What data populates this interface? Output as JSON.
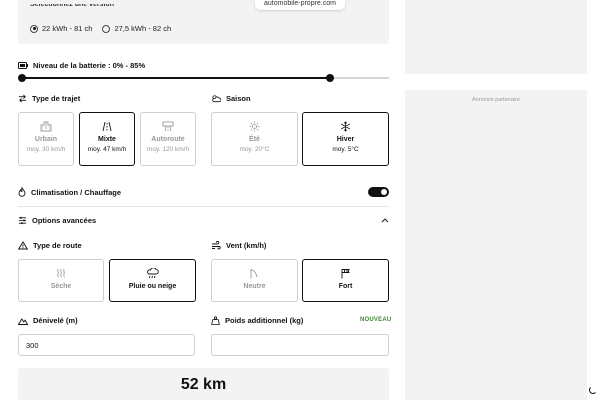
{
  "browser": {
    "url": "automobile-propre.com"
  },
  "version": {
    "heading": "Sélectionnez une version",
    "options": [
      {
        "label": "22 kWh - 81 ch",
        "selected": true
      },
      {
        "label": "27,5 kWh - 82 ch",
        "selected": false
      }
    ]
  },
  "battery": {
    "label": "Niveau de la batterie : 0% - 85%",
    "min_percent": 0,
    "max_percent": 85
  },
  "trip_type": {
    "label": "Type de trajet",
    "options": [
      {
        "title": "Urbain",
        "sub": "moy. 30 km/h",
        "icon": "building-icon",
        "selected": false
      },
      {
        "title": "Mixte",
        "sub": "moy. 47 km/h",
        "icon": "mixed-road-icon",
        "selected": true
      },
      {
        "title": "Autoroute",
        "sub": "moy. 120 km/h",
        "icon": "highway-icon",
        "selected": false
      }
    ]
  },
  "season": {
    "label": "Saison",
    "options": [
      {
        "title": "Été",
        "sub": "moy. 20°C",
        "icon": "sun-icon",
        "selected": false
      },
      {
        "title": "Hiver",
        "sub": "moy. 5°C",
        "icon": "snowflake-icon",
        "selected": true
      }
    ]
  },
  "climate": {
    "label": "Climatisation / Chauffage",
    "enabled": true
  },
  "advanced": {
    "label": "Options avancées",
    "expanded": true
  },
  "road_type": {
    "label": "Type de route",
    "options": [
      {
        "title": "Sèche",
        "icon": "heat-waves-icon",
        "selected": false
      },
      {
        "title": "Pluie ou neige",
        "icon": "rain-cloud-icon",
        "selected": true
      }
    ]
  },
  "wind": {
    "label": "Vent (km/h)",
    "options": [
      {
        "title": "Neutre",
        "icon": "windsock-light-icon",
        "selected": false
      },
      {
        "title": "Fort",
        "icon": "windsock-strong-icon",
        "selected": true
      }
    ]
  },
  "elevation": {
    "label": "Dénivelé (m)",
    "value": "300"
  },
  "extra_weight": {
    "label": "Poids additionnel (kg)",
    "value": "",
    "badge": "NOUVEAU"
  },
  "result": {
    "value": "52 km"
  },
  "ad": {
    "label": "Annonce partenaire"
  }
}
